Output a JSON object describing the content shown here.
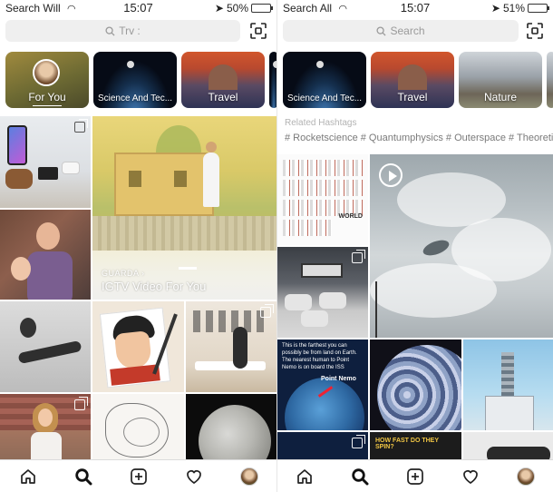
{
  "left": {
    "status": {
      "carrier": "Search Will",
      "time": "15:07",
      "battery": "50%",
      "battery_level": 0.5
    },
    "search": {
      "placeholder": "Trv :"
    },
    "categories": [
      {
        "label": "For You"
      },
      {
        "label": "Science And Tec..."
      },
      {
        "label": "Travel"
      }
    ],
    "igtv": {
      "guarda": "GUARDA ›",
      "title": "IGTV Video For You"
    }
  },
  "right": {
    "status": {
      "carrier": "Search All",
      "time": "15:07",
      "battery": "51%",
      "battery_level": 0.51
    },
    "search": {
      "placeholder": "Search"
    },
    "categories": [
      {
        "label": "Science And Tec..."
      },
      {
        "label": "Travel"
      },
      {
        "label": "Nature"
      }
    ],
    "related_label": "Related Hashtags",
    "hashtags": "# Rocketscience # Quantumphysics # Outerspace # Theoretic C",
    "earth_text": "This is the farthest you can possibly be from land on Earth. The nearest human to Point Nemo is on board the ISS",
    "point_nemo": "Point Nemo",
    "rockets_label": "WORLD",
    "spin_label": "HOW FAST DO THEY SPIN?"
  },
  "nav": {
    "items": [
      {
        "icon": "home-icon"
      },
      {
        "icon": "search-icon"
      },
      {
        "icon": "add-post-icon"
      },
      {
        "icon": "heart-icon"
      },
      {
        "icon": "profile-avatar"
      }
    ]
  }
}
